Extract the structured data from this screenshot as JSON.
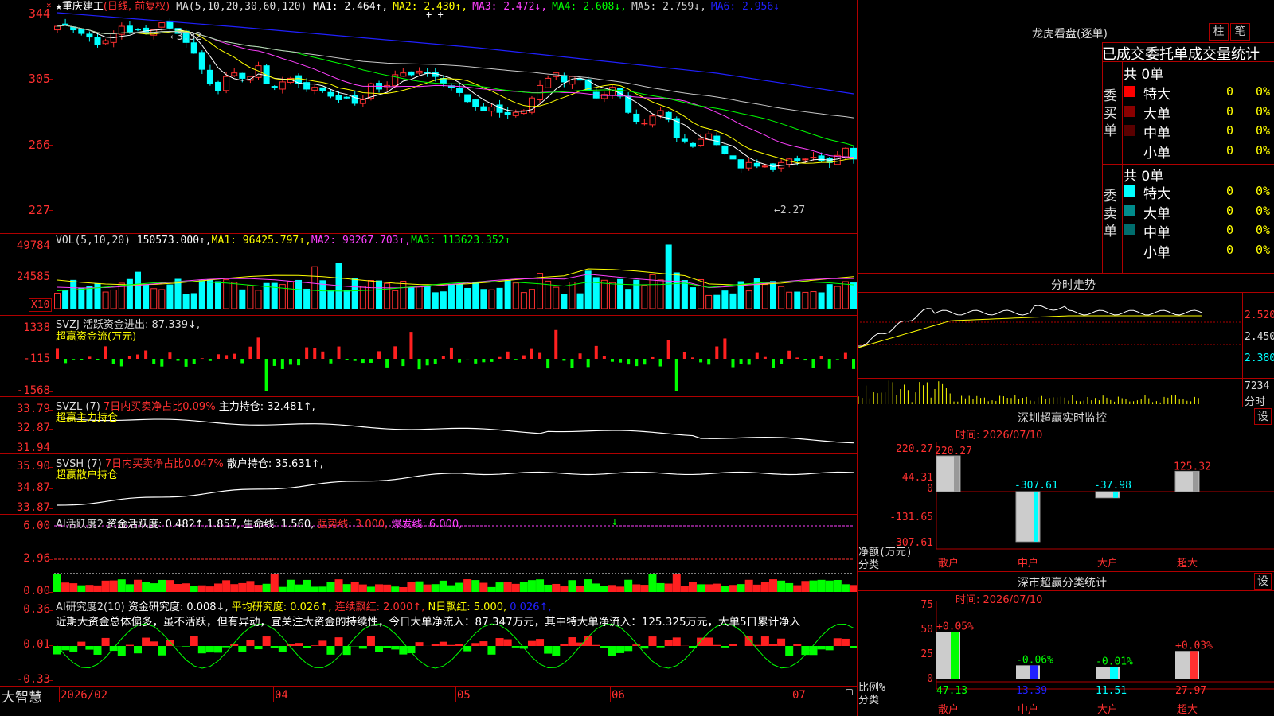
{
  "app": {
    "brand": "大智慧"
  },
  "stock": {
    "star": "★",
    "name": "重庆建工",
    "mode": "(日线, 前复权)"
  },
  "main": {
    "ma_prefix": "MA(5,10,20,30,60,120)",
    "ma": [
      {
        "label": "MA1: 2.464↑,",
        "color": "#ffffff"
      },
      {
        "label": "MA2: 2.430↑,",
        "color": "#ffff00"
      },
      {
        "label": "MA3: 2.472↓,",
        "color": "#ff40ff"
      },
      {
        "label": "MA4: 2.608↓,",
        "color": "#00ff00"
      },
      {
        "label": "MA5: 2.759↓,",
        "color": "#d0d0d0"
      },
      {
        "label": "MA6: 2.956↓",
        "color": "#2020ff"
      }
    ],
    "y_ticks": [
      "344",
      "305",
      "266",
      "227"
    ],
    "high_note": "←3.32",
    "low_note": "←2.27"
  },
  "volume": {
    "prefix": "VOL(5,10,20)",
    "value": "150573.000↑,",
    "ma": [
      {
        "label": "MA1: 96425.797↑,",
        "color": "#ffff00"
      },
      {
        "label": "MA2: 99267.703↑,",
        "color": "#ff40ff"
      },
      {
        "label": "MA3: 113623.352↑",
        "color": "#00ff00"
      }
    ],
    "y_ticks": [
      "49784",
      "24585"
    ],
    "unit": "X10"
  },
  "svzj": {
    "title": "SVZJ  活跃资金进出: 87.339↓,",
    "subtitle": "超赢资金流(万元)",
    "y_ticks": [
      "1338",
      "-115",
      "-1568"
    ]
  },
  "svzl": {
    "title1": "SVZL (7)",
    "title2": "7日内买卖净占比0.09%",
    "title3": "主力持仓: 32.481↑,",
    "subtitle": "超赢主力持仓",
    "y_ticks": [
      "33.79",
      "32.87",
      "31.94"
    ]
  },
  "svsh": {
    "title1": "SVSH (7)",
    "title2": "7日内买卖净占比0.047%",
    "title3": "散户持仓: 35.631↑,",
    "subtitle": "超赢散户持仓",
    "y_ticks": [
      "35.90",
      "34.87",
      "33.87"
    ]
  },
  "ai_active": {
    "t1": "AI活跃度2",
    "t2": "资金活跃度: 0.482↑,1.857,",
    "t3": "生命线: 1.560,",
    "t4": "强势线: 3.000,",
    "t5": "爆发线: 6.000,",
    "y_ticks": [
      "6.00",
      "2.96",
      "0.00"
    ]
  },
  "ai_research": {
    "t1": "AI研究度2(10)",
    "t2": "资金研究度: 0.008↓,",
    "t3": "平均研究度: 0.026↑,",
    "t4": "连续飘红: 2.000↑,",
    "t5": "N日飘红: 5.000,",
    "t6": "0.026↑,",
    "comment": "近期大资金总体偏多，虽不活跃，但有异动，宜关注大资金的持续性，今日大单净流入：87.347万元，其中特大单净流入：125.325万元，大单5日累计净入",
    "y_ticks": [
      "0.36",
      "0.01",
      "-0.33"
    ]
  },
  "date_axis": [
    "2026/02",
    "04",
    "05",
    "06",
    "07"
  ],
  "dragon": {
    "title": "龙虎看盘(逐单)",
    "btn_column": "柱",
    "btn_stroke": "笔",
    "subtitle": "已成交委托单成交量统计",
    "buy": {
      "side": "委买单",
      "total": "共 0单",
      "rows": [
        {
          "name": "特大",
          "v": "0",
          "p": "0%",
          "color": "#ff0000"
        },
        {
          "name": "大单",
          "v": "0",
          "p": "0%",
          "color": "#8b0000"
        },
        {
          "name": "中单",
          "v": "0",
          "p": "0%",
          "color": "#5a0000"
        },
        {
          "name": "小单",
          "v": "0",
          "p": "0%",
          "color": "#000000"
        }
      ]
    },
    "sell": {
      "side": "委卖单",
      "total": "共 0单",
      "rows": [
        {
          "name": "特大",
          "v": "0",
          "p": "0%",
          "color": "#00ffff"
        },
        {
          "name": "大单",
          "v": "0",
          "p": "0%",
          "color": "#008b8b"
        },
        {
          "name": "中单",
          "v": "0",
          "p": "0%",
          "color": "#006d6d"
        },
        {
          "name": "小单",
          "v": "0",
          "p": "0%",
          "color": "#000000"
        }
      ]
    }
  },
  "intraday": {
    "title": "分时走势",
    "y_ticks": [
      "2.520",
      "2.450",
      "2.380"
    ],
    "vol_tick": "7234",
    "vol_label": "分时"
  },
  "sz_monitor": {
    "title": "深圳超赢实时监控",
    "btn": "设",
    "date": "时间: 2026/07/10",
    "y_ticks": [
      "220.27",
      "44.31",
      "0",
      "-131.65",
      "-307.61"
    ],
    "axis_label": "净额(万元)",
    "axis_label2": "分类",
    "bars": [
      {
        "cat": "散户",
        "value": "220.27"
      },
      {
        "cat": "中户",
        "value": "-307.61"
      },
      {
        "cat": "大户",
        "value": "-37.98"
      },
      {
        "cat": "超大",
        "value": "125.32"
      }
    ]
  },
  "sz_stat": {
    "title": "深市超赢分类统计",
    "btn": "设",
    "date": "时间: 2026/07/10",
    "y_ticks": [
      "75",
      "50",
      "25",
      "0"
    ],
    "axis_label": "比例%",
    "axis_label2": "分类",
    "bars": [
      {
        "cat": "散户",
        "delta": "+0.05%",
        "value": "47.13"
      },
      {
        "cat": "中户",
        "delta": "-0.06%",
        "value": "13.39"
      },
      {
        "cat": "大户",
        "delta": "-0.01%",
        "value": "11.51"
      },
      {
        "cat": "超大",
        "delta": "+0.03%",
        "value": "27.97"
      }
    ]
  },
  "chart_data": {
    "type": "candlestick",
    "x_labels": [
      "2026/02",
      "04",
      "05",
      "06",
      "07"
    ],
    "price_range": [
      2.27,
      3.44
    ],
    "high": 3.32,
    "low": 2.27,
    "close": [
      3.34,
      3.35,
      3.32,
      3.3,
      3.28,
      3.24,
      3.26,
      3.3,
      3.34,
      3.31,
      3.32,
      3.3,
      3.32,
      3.36,
      3.33,
      3.3,
      3.25,
      3.19,
      3.1,
      3.02,
      2.98,
      3.06,
      3.08,
      3.05,
      3.06,
      3.12,
      3.02,
      3.0,
      3.03,
      3.05,
      3.02,
      2.99,
      3.0,
      2.98,
      2.95,
      2.93,
      2.94,
      2.91,
      2.93,
      3.02,
      2.99,
      3.01,
      3.07,
      3.08,
      3.07,
      3.09,
      3.08,
      3.06,
      3.02,
      3.0,
      2.97,
      2.92,
      2.89,
      2.87,
      2.89,
      2.86,
      2.85,
      2.86,
      2.87,
      2.94,
      3.01,
      3.05,
      3.08,
      3.03,
      3.06,
      3.04,
      2.98,
      2.94,
      2.96,
      3.0,
      2.95,
      2.86,
      2.81,
      2.8,
      2.84,
      2.87,
      2.82,
      2.72,
      2.7,
      2.67,
      2.71,
      2.74,
      2.68,
      2.63,
      2.6,
      2.55,
      2.58,
      2.56,
      2.56,
      2.54,
      2.58,
      2.6,
      2.59,
      2.6,
      2.61,
      2.59,
      2.58,
      2.62,
      2.66,
      2.6
    ],
    "volume_scale": "X10",
    "fund_flow_range": [
      -1568,
      1338
    ],
    "main_hold": {
      "last": 32.481,
      "range": [
        31.94,
        33.79
      ]
    },
    "retail_hold": {
      "last": 35.631,
      "range": [
        33.87,
        35.9
      ]
    },
    "active_range": [
      0,
      6.0
    ],
    "research_range": [
      -0.33,
      0.36
    ]
  }
}
